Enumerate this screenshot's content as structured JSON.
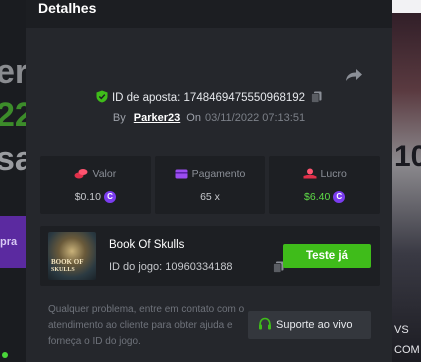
{
  "background": {
    "left_lines": [
      "er",
      "22",
      "sa"
    ],
    "left_button": "pra",
    "right_number": "10",
    "right_texts": [
      "VS",
      "COM"
    ],
    "search_placeholder": ""
  },
  "modal": {
    "title": "Detalhes",
    "bet": {
      "id_label": "ID de aposta: 1748469475550968192",
      "by_label": "By",
      "user": "Parker23",
      "on_label": "On",
      "date": "03/11/2022 07:13:51"
    },
    "stats": [
      {
        "label": "Valor",
        "value": "$0.10",
        "icon": "coins-icon",
        "icon_color": "#e0304a",
        "value_color": "#c6c8cc",
        "coin": true
      },
      {
        "label": "Pagamento",
        "value": "65 x",
        "icon": "card-icon",
        "icon_color": "#9a4cf0",
        "value_color": "#c6c8cc",
        "coin": false
      },
      {
        "label": "Lucro",
        "value": "$6.40",
        "icon": "hand-coins-icon",
        "icon_color": "#e0304a",
        "value_color": "#5fdc48",
        "coin": true
      }
    ],
    "game": {
      "name": "Book Of Skulls",
      "id_label": "ID do jogo: 10960334188",
      "thumb_line1": "BOOK OF",
      "thumb_line2": "SKULLS",
      "try_label": "Teste já"
    },
    "help_text": "Qualquer problema, entre em contato com o atendimento ao cliente para obter ajuda e forneça o ID do jogo.",
    "support_label": "Suporte ao vivo"
  },
  "colors": {
    "accent_green": "#3fbc1a",
    "profit_green": "#5fdc48",
    "coin_purple": "#7b3cf0",
    "shield_green": "#3fbc1a"
  }
}
